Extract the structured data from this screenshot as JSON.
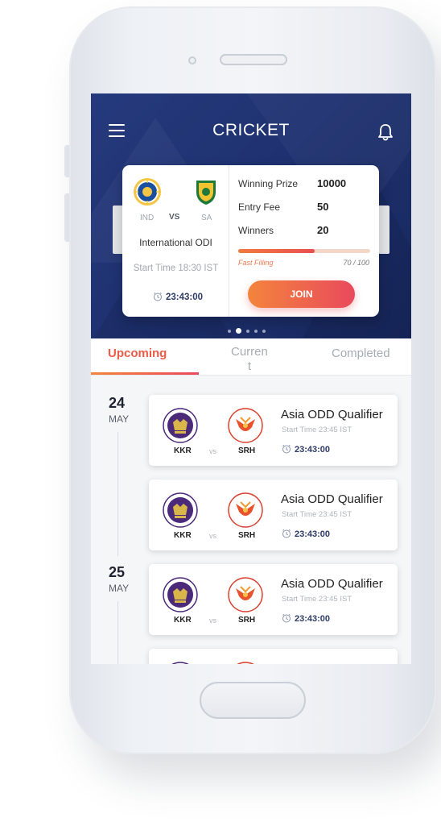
{
  "app": {
    "title": "CRICKET"
  },
  "featured": {
    "team1": "IND",
    "vs": "VS",
    "team2": "SA",
    "match_type": "International ODI",
    "start_time": "Start Time 18:30 IST",
    "countdown": "23:43:00",
    "winning_prize_label": "Winning Prize",
    "winning_prize_value": "10000",
    "entry_fee_label": "Entry Fee",
    "entry_fee_value": "50",
    "winners_label": "Winners",
    "winners_value": "20",
    "fill_status": "Fast Filling",
    "fill_count": "70 / 100",
    "fill_fraction": 0.58,
    "join_label": "JOIN"
  },
  "carousel": {
    "count": 5,
    "active_index": 1
  },
  "tabs": {
    "upcoming": "Upcoming",
    "current_line1": "Curren",
    "current_line2": "t",
    "completed": "Completed"
  },
  "groups": [
    {
      "day": "24",
      "month": "MAY",
      "matches": [
        {
          "title": "Asia ODD Qualifier",
          "team1": "KKR",
          "vs": "vs",
          "team2": "SRH",
          "start": "Start Time  23:45 IST",
          "countdown": "23:43:00"
        },
        {
          "title": "Asia ODD Qualifier",
          "team1": "KKR",
          "vs": "vs",
          "team2": "SRH",
          "start": "Start Time  23:45 IST",
          "countdown": "23:43:00"
        }
      ]
    },
    {
      "day": "25",
      "month": "MAY",
      "matches": [
        {
          "title": "Asia ODD Qualifier",
          "team1": "KKR",
          "vs": "vs",
          "team2": "SRH",
          "start": "Start Time  23:45 IST",
          "countdown": "23:43:00"
        }
      ]
    }
  ],
  "colors": {
    "hero_blue": "#1f3170",
    "accent_orange": "#f3843c",
    "accent_red": "#e94a5c",
    "kkr_purple": "#4b2a7a",
    "srh_red": "#d9412f"
  }
}
